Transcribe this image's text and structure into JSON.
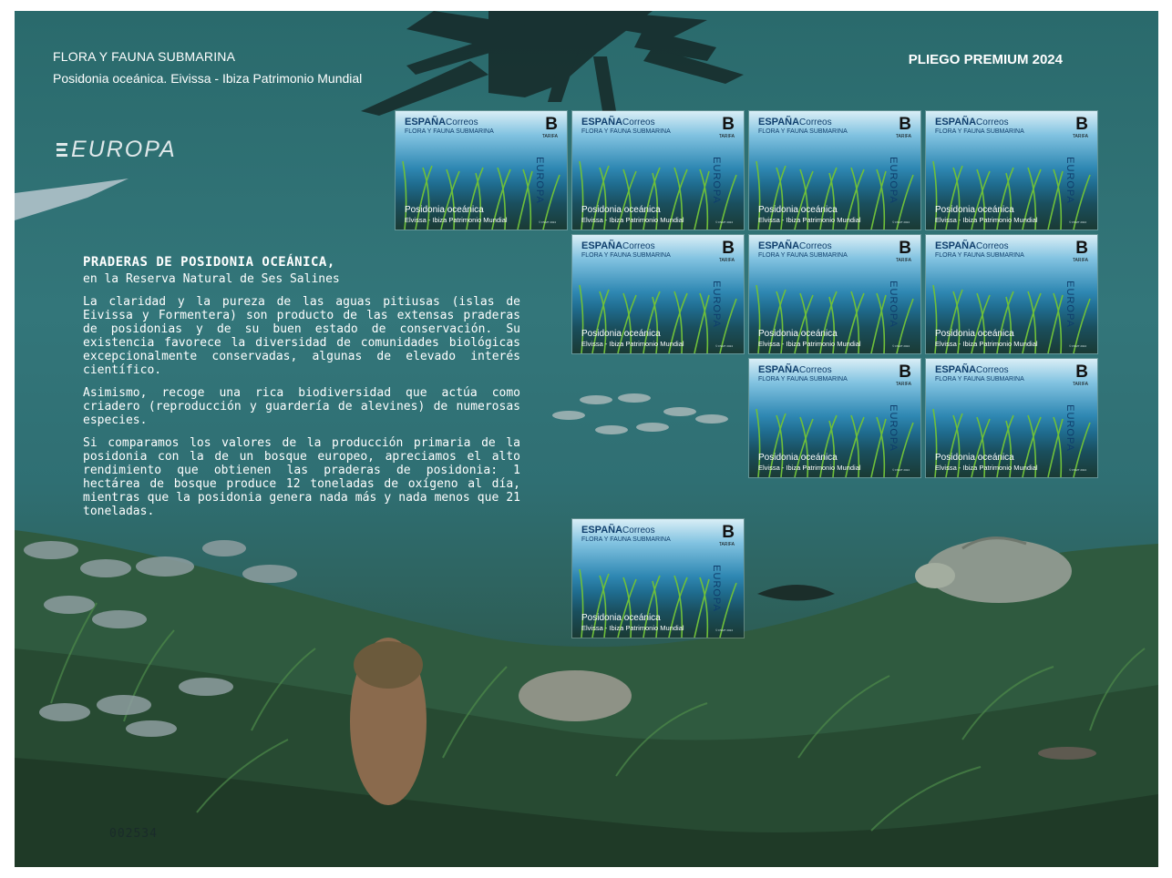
{
  "header": {
    "title": "FLORA Y FAUNA SUBMARINA",
    "subtitle": "Posidonia oceánica. Eivissa - Ibiza Patrimonio Mundial",
    "premium": "PLIEGO PREMIUM 2024"
  },
  "europa_logo": "EUROPA",
  "text": {
    "title": "PRADERAS DE POSIDONIA OCEÁNICA,",
    "subtitle": "en la Reserva Natural de Ses Salines",
    "paragraphs": [
      "La claridad y la pureza de las aguas pitiusas (islas de Eivissa y Formentera) son producto de las extensas praderas de posidonias y de su buen estado de conservación. Su existencia favorece la diversidad de comunidades biológicas excepcionalmente conservadas, algunas de elevado interés científico.",
      "Asimismo, recoge una rica biodiversidad que actúa como criadero (reproducción y guardería de alevines) de numerosas especies.",
      "Si comparamos los valores de la producción primaria de la posidonia con la de un bosque europeo, apreciamos el alto rendimiento que obtienen las praderas de posidonia: 1 hectárea de bosque produce 12 toneladas de oxígeno al día, mientras que la posidonia genera nada más y nada menos que 21 toneladas."
    ]
  },
  "stamp": {
    "country": "ESPAÑA",
    "correos": "Correos",
    "series": "FLORA Y FAUNA SUBMARINA",
    "value": "B",
    "tarifa": "TARIFA",
    "europa": "EUROPA",
    "name": "Posidonia oceánica",
    "place": "Elvissa - Ibiza Patrimonio Mundial",
    "footer": "© FNMT 2024"
  },
  "serial": "002534",
  "colors": {
    "sea_top": "#2a6a6c",
    "sea_bottom": "#233f34",
    "stamp_text": "#0f3e6c",
    "grass": "#5fa832"
  },
  "icons": [
    "europa-logo-icon",
    "fish-icon",
    "turtle-icon",
    "pen-shell-icon",
    "sun-rays-icon"
  ]
}
